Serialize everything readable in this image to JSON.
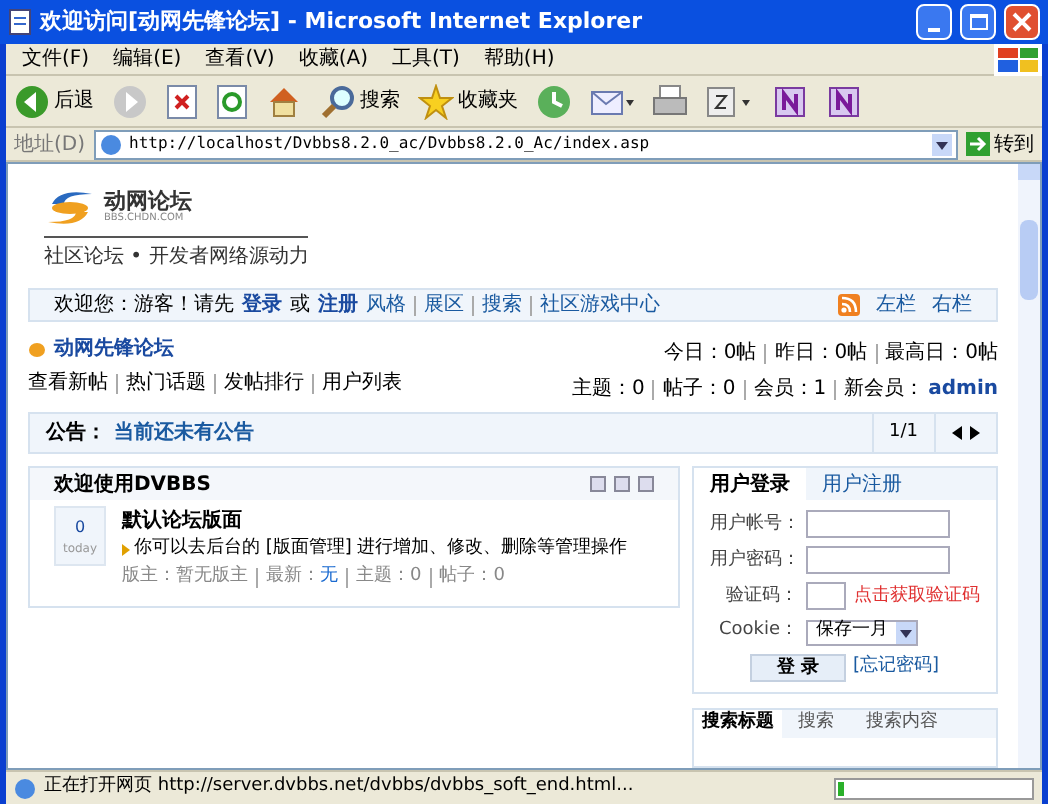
{
  "window": {
    "title": "欢迎访问[动网先锋论坛] - Microsoft Internet Explorer"
  },
  "menu": [
    "文件(F)",
    "编辑(E)",
    "查看(V)",
    "收藏(A)",
    "工具(T)",
    "帮助(H)"
  ],
  "toolbar": [
    {
      "kind": "back",
      "label": "后退"
    },
    {
      "kind": "forward"
    },
    {
      "kind": "stop"
    },
    {
      "kind": "refresh"
    },
    {
      "kind": "home"
    },
    {
      "kind": "search",
      "label": "搜索"
    },
    {
      "kind": "favorites",
      "label": "收藏夹"
    },
    {
      "kind": "history"
    },
    {
      "kind": "mail"
    },
    {
      "kind": "print"
    },
    {
      "kind": "edit"
    },
    {
      "kind": "note"
    },
    {
      "kind": "note"
    }
  ],
  "address_bar": {
    "label": "地址(D)",
    "value": "http://localhost/Dvbbs8.2.0_ac/Dvbbs8.2.0_Ac/index.asp",
    "go": "转到"
  },
  "logo": {
    "name": "动网论坛",
    "domain": "BBS.CHDN.COM",
    "slogan": "社区论坛 • 开发者网络源动力"
  },
  "nav": {
    "greeting": "欢迎您：游客！请先",
    "login": "登录",
    "or": "或",
    "register": "注册",
    "links": [
      "风格",
      "展区",
      "搜索",
      "社区游戏中心"
    ],
    "right": [
      "左栏",
      "右栏"
    ]
  },
  "forum": {
    "title": "动网先锋论坛",
    "links": [
      "查看新帖",
      "热门话题",
      "发帖排行",
      "用户列表"
    ],
    "stats": [
      "今日：0帖",
      "昨日：0帖",
      "最高日：0帖"
    ],
    "stats2": [
      "主题：0",
      "帖子：0",
      "会员：1",
      "新会员："
    ],
    "newest_member": "admin"
  },
  "announcement": {
    "label": "公告：",
    "text": "当前还未有公告",
    "page": "1/1"
  },
  "welcome": {
    "title": "欢迎使用DVBBS",
    "board": {
      "count": "0",
      "day": "today",
      "name": "默认论坛版面",
      "description": "你可以去后台的 [版面管理] 进行增加、修改、删除等管理操作",
      "moderator": "版主：暂无版主",
      "latest_label": "最新：",
      "latest": "无",
      "stats": [
        "主题：0",
        "帖子：0"
      ]
    }
  },
  "login": {
    "tabs": [
      {
        "label": "用户登录",
        "selected": true
      },
      {
        "label": "用户注册",
        "selected": false
      }
    ],
    "username_label": "用户帐号：",
    "password_label": "用户密码：",
    "captcha_label": "验证码：",
    "captcha_link": "点击获取验证码",
    "cookie_label": "Cookie：",
    "cookie_value": "保存一月",
    "submit": "登 录",
    "forgot": "[忘记密码]"
  },
  "search": {
    "tabs": [
      {
        "label": "搜索标题",
        "selected": true
      },
      {
        "label": "搜索",
        "selected": false
      },
      {
        "label": "搜索内容",
        "selected": false
      }
    ]
  },
  "status_bar": {
    "text": "正在打开网页 http://server.dvbbs.net/dvbbs/dvbbs_soft_end.html...",
    "level": 0.03
  }
}
